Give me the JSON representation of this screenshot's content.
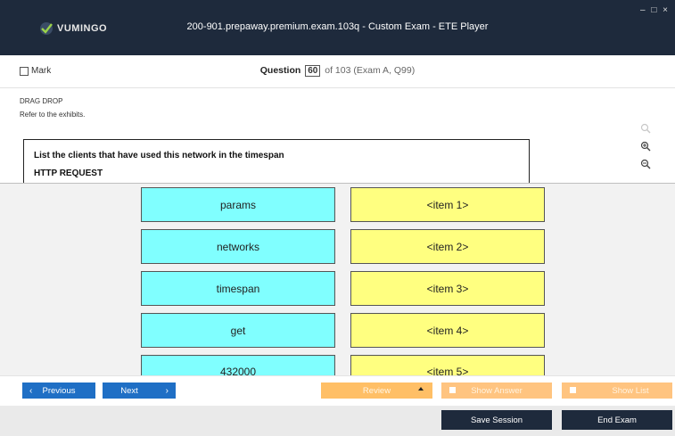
{
  "window": {
    "title": "200-901.prepaway.premium.exam.103q - Custom Exam - ETE Player",
    "logo_text": "VUMINGO",
    "controls": "– □ ×"
  },
  "question_bar": {
    "mark_label": "Mark",
    "question_label": "Question",
    "question_number": "60",
    "of_text": "of 103 (Exam A, Q99)"
  },
  "question": {
    "type": "DRAG DROP",
    "instruction": "Refer to the exhibits."
  },
  "exhibit": {
    "line1": "List the clients that have used this network in the timespan",
    "line2": "HTTP REQUEST"
  },
  "answer_area": {
    "left_tiles": [
      "params",
      "networks",
      "timespan",
      "get",
      "432000"
    ],
    "right_tiles": [
      "<item 1>",
      "<item 2>",
      "<item 3>",
      "<item 4>",
      "<item 5>"
    ]
  },
  "nav": {
    "previous": "Previous",
    "next": "Next",
    "review": "Review",
    "show_answer": "Show Answer",
    "show_list": "Show List",
    "save_session": "Save Session",
    "end_exam": "End Exam"
  },
  "colors": {
    "titlebar": "#1e2a3c",
    "nav_blue": "#1f6fc5",
    "orange": "#ffc480",
    "tile_cyan": "#80ffff",
    "tile_yellow": "#ffff80"
  }
}
